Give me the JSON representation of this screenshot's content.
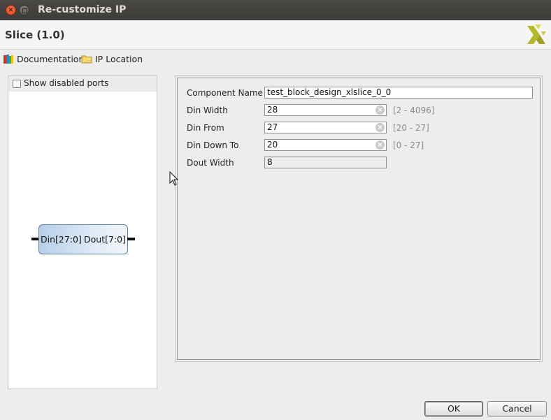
{
  "window": {
    "title": "Re-customize IP"
  },
  "header": {
    "ip_name": "Slice (1.0)"
  },
  "toolbar": {
    "documentation": "Documentation",
    "ip_location": "IP Location"
  },
  "left_panel": {
    "show_disabled_ports": "Show disabled ports",
    "show_disabled_checked": false,
    "symbol": {
      "input_port": "Din[27:0]",
      "output_port": "Dout[7:0]"
    }
  },
  "params": {
    "component_name": {
      "label": "Component Name",
      "value": "test_block_design_xlslice_0_0"
    },
    "din_width": {
      "label": "Din Width",
      "value": "28",
      "range": "[2 - 4096]"
    },
    "din_from": {
      "label": "Din From",
      "value": "27",
      "range": "[20 - 27]"
    },
    "din_down_to": {
      "label": "Din Down To",
      "value": "20",
      "range": "[0 - 27]"
    },
    "dout_width": {
      "label": "Dout Width",
      "value": "8"
    }
  },
  "buttons": {
    "ok": "OK",
    "cancel": "Cancel"
  },
  "colors": {
    "accent_logo": "#b5b82b",
    "symbol_border": "#5a7ea8",
    "titlebar": "#3c3b37"
  }
}
